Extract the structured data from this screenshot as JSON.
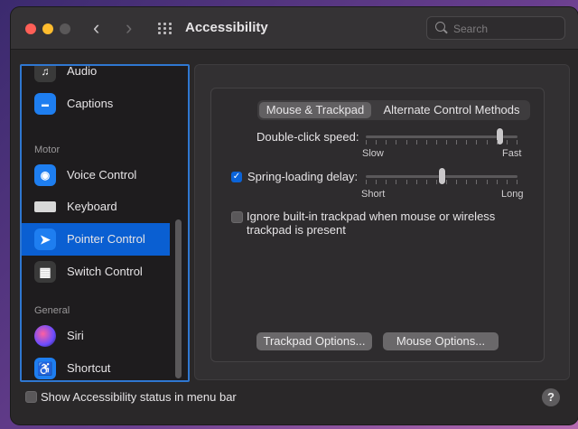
{
  "window": {
    "title": "Accessibility"
  },
  "search": {
    "placeholder": "Search"
  },
  "sidebar": {
    "items": [
      {
        "label": "Audio",
        "icon": "audio-icon"
      },
      {
        "label": "Captions",
        "icon": "captions-icon"
      },
      {
        "section": "Motor"
      },
      {
        "label": "Voice Control",
        "icon": "voice-control-icon"
      },
      {
        "label": "Keyboard",
        "icon": "keyboard-icon"
      },
      {
        "label": "Pointer Control",
        "icon": "pointer-icon",
        "selected": true
      },
      {
        "label": "Switch Control",
        "icon": "switch-control-icon"
      },
      {
        "section": "General"
      },
      {
        "label": "Siri",
        "icon": "siri-icon"
      },
      {
        "label": "Shortcut",
        "icon": "shortcut-icon"
      }
    ]
  },
  "tabs": {
    "active": "Mouse & Trackpad",
    "other": "Alternate Control Methods"
  },
  "double_click": {
    "label": "Double-click speed:",
    "min_label": "Slow",
    "max_label": "Fast",
    "value_fraction": 0.9
  },
  "spring_loading": {
    "label": "Spring-loading delay:",
    "checked": true,
    "min_label": "Short",
    "max_label": "Long",
    "value_fraction": 0.5
  },
  "ignore_trackpad": {
    "label": "Ignore built-in trackpad when mouse or wireless trackpad is present",
    "checked": false
  },
  "buttons": {
    "trackpad_options": "Trackpad Options...",
    "mouse_options": "Mouse Options..."
  },
  "footer": {
    "status_label": "Show Accessibility status in menu bar",
    "checked": false,
    "help": "?"
  },
  "colors": {
    "accent": "#0a5fd2",
    "selection_outline": "#2f77d1"
  }
}
